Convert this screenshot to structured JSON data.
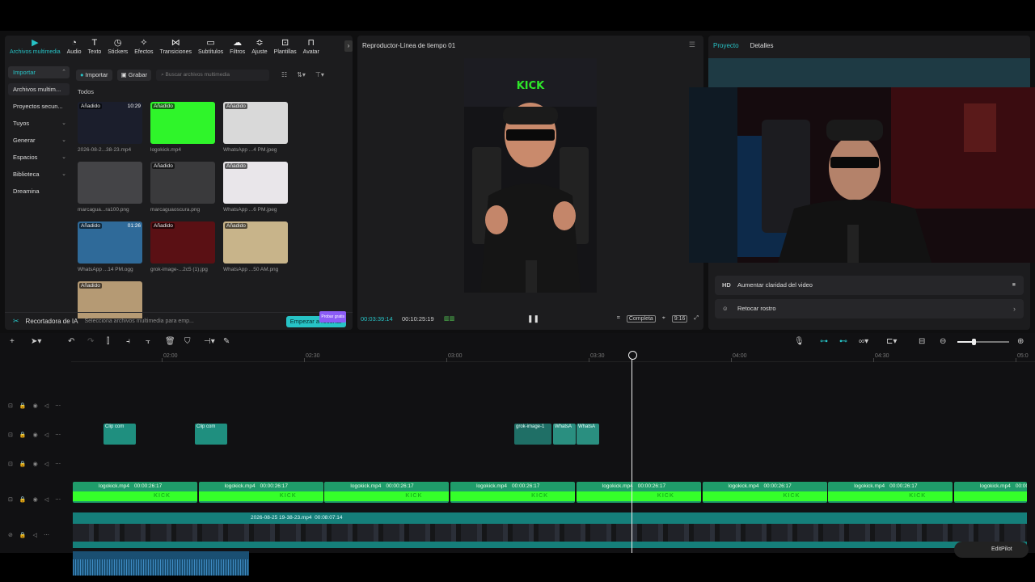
{
  "media": {
    "tools": [
      {
        "label": "Archivos multimedia",
        "icon": "play-square-icon",
        "glyph": "▶"
      },
      {
        "label": "Audio",
        "icon": "audio-icon",
        "glyph": "◔"
      },
      {
        "label": "Texto",
        "icon": "text-icon",
        "glyph": "T"
      },
      {
        "label": "Stickers",
        "icon": "sticker-icon",
        "glyph": "◷"
      },
      {
        "label": "Efectos",
        "icon": "effects-icon",
        "glyph": "✧"
      },
      {
        "label": "Transiciones",
        "icon": "transition-icon",
        "glyph": "⋈"
      },
      {
        "label": "Subtítulos",
        "icon": "subtitle-icon",
        "glyph": "▭"
      },
      {
        "label": "Filtros",
        "icon": "filter-icon",
        "glyph": "☁"
      },
      {
        "label": "Ajuste",
        "icon": "adjust-icon",
        "glyph": "≎"
      },
      {
        "label": "Plantillas",
        "icon": "template-icon",
        "glyph": "⊡"
      },
      {
        "label": "Avatar",
        "icon": "avatar-icon",
        "glyph": "⊓"
      }
    ],
    "sidebar": [
      {
        "label": "Importar"
      },
      {
        "label": "Archivos multim..."
      },
      {
        "label": "Proyectos secun..."
      },
      {
        "label": "Tuyos"
      },
      {
        "label": "Generar"
      },
      {
        "label": "Espacios"
      },
      {
        "label": "Biblioteca"
      },
      {
        "label": "Dreamina"
      }
    ],
    "import_btn": "Importar",
    "record_btn": "Grabar",
    "search_placeholder": "Buscar archivos multimedia",
    "all_label": "Todos",
    "items": [
      {
        "name": "2026-08-2...38-23.mp4",
        "tag": "Añadido",
        "dur": "10:29",
        "color": "#1b1e2c"
      },
      {
        "name": "logokick.mp4",
        "tag": "Añadido",
        "dur": "",
        "color": "#2ff52a"
      },
      {
        "name": "WhatsApp ...4 PM.jpeg",
        "tag": "Añadido",
        "dur": "",
        "color": "#d9d9d9"
      },
      {
        "name": "marcagua...ra100.png",
        "tag": "",
        "dur": "",
        "color": "#444447"
      },
      {
        "name": "marcaguaoscura.png",
        "tag": "Añadido",
        "dur": "",
        "color": "#3a3a3c"
      },
      {
        "name": "WhatsApp ...6 PM.jpeg",
        "tag": "Añadido",
        "dur": "",
        "color": "#e9e6ea"
      },
      {
        "name": "WhatsApp ...14 PM.ogg",
        "tag": "Añadido",
        "dur": "01:26",
        "color": "#2f6a99"
      },
      {
        "name": "grok-image-...2c5 (1).jpg",
        "tag": "Añadido",
        "dur": "",
        "color": "#5a1014"
      },
      {
        "name": "WhatsApp ...50 AM.png",
        "tag": "Añadido",
        "dur": "",
        "color": "#c8b48a"
      },
      {
        "name": "",
        "tag": "Añadido",
        "dur": "",
        "color": "#b59a74"
      }
    ],
    "ai_cropper": "Recortadora de IA",
    "ai_hint": "Selecciona archivos multimedia para emp...",
    "ai_btn": "Empezar a recortar",
    "ai_new": "Probar gratis"
  },
  "player": {
    "title": "Reproductor-Línea de tiempo 01",
    "timecode_current": "00:03:39:14",
    "timecode_total": "00:10:25:19",
    "full_label": "Completa",
    "ratio": "9:16"
  },
  "props": {
    "tab_project": "Proyecto",
    "tab_details": "Detalles",
    "enhance_icon": "HD",
    "enhance_label": "Aumentar claridad del video",
    "retouch_label": "Retocar rostro"
  },
  "timeline": {
    "ruler": [
      "02:00",
      "02:30",
      "03:00",
      "03:30",
      "04:00",
      "04:30",
      "05:0"
    ],
    "logo_label": "logokick.mp4",
    "logo_dur": "00:00:26:17",
    "kick_text": "KICK",
    "main_label": "2026-08-25 19-38-23.mp4",
    "main_dur": "00:08:07:14",
    "clip_label": "Clip com",
    "grok_label": "grok-image-1",
    "whats_label": "WhatsA",
    "pilot": "EditPilot"
  },
  "colors": {
    "accent": "#27c3c6",
    "kick_green": "#35ff2a"
  }
}
